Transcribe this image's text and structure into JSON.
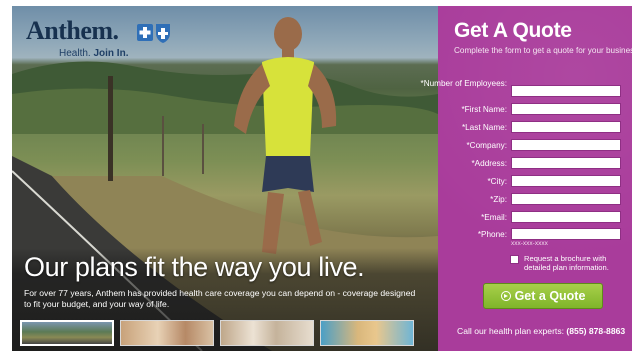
{
  "brand": {
    "logo_word": "Anthem.",
    "tagline_prefix": "Health.",
    "tagline_bold": "Join In.",
    "bcbs_icon": "blue-cross-blue-shield-icon"
  },
  "hero": {
    "headline": "Our plans fit the way you live.",
    "body": "For over 77 years, Anthem has provided health care coverage you can depend on - coverage designed to fit your budget, and your way of life.",
    "thumbnails": [
      {
        "name": "runner-thumbnail",
        "active": true
      },
      {
        "name": "family-thumbnail",
        "active": false
      },
      {
        "name": "seniors-thumbnail",
        "active": false
      },
      {
        "name": "beach-thumbnail",
        "active": false
      }
    ]
  },
  "form": {
    "title": "Get A Quote",
    "subtitle": "Complete the form to get a quote for your business.",
    "fields": [
      {
        "label": "*Number of Employees:",
        "value": ""
      },
      {
        "label": "*First Name:",
        "value": ""
      },
      {
        "label": "*Last Name:",
        "value": ""
      },
      {
        "label": "*Company:",
        "value": ""
      },
      {
        "label": "*Address:",
        "value": ""
      },
      {
        "label": "*City:",
        "value": ""
      },
      {
        "label": "*Zip:",
        "value": ""
      },
      {
        "label": "*Email:",
        "value": ""
      },
      {
        "label": "*Phone:",
        "value": ""
      }
    ],
    "phone_hint": "xxx-xxx-xxxx",
    "brochure_label": "Request a brochure with detailed plan information.",
    "brochure_checked": false,
    "submit_label": "Get a Quote",
    "call_text": "Call our health plan experts:",
    "call_number": "(855) 878-8863"
  },
  "colors": {
    "panel": "#a93c9b",
    "button": "#8cc031",
    "logo": "#17314f"
  }
}
